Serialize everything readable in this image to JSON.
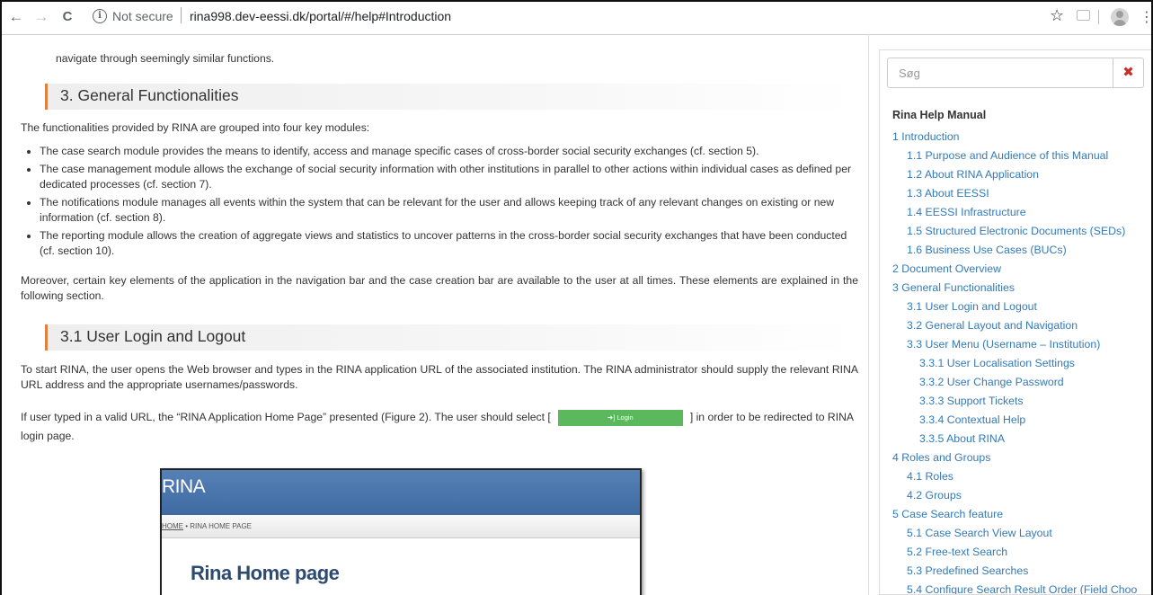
{
  "browser": {
    "back_icon": "←",
    "forward_icon": "→",
    "reload_icon": "C",
    "info_icon": "i",
    "security_label": "Not secure",
    "url": "rina998.dev-eessi.dk/portal/#/help#Introduction",
    "star_icon": "☆",
    "menu_icon": "⋮"
  },
  "content": {
    "top_line": "navigate through seemingly similar functions.",
    "section3_heading": "3. General Functionalities",
    "section3_intro": "The functionalities provided by RINA are grouped into four key modules:",
    "bullets": [
      "The case search module provides the means to identify, access and manage specific cases of cross-border social security exchanges (cf. section 5).",
      "The case management module allows the exchange of social security information with other institutions in parallel to other actions within individual cases as defined per dedicated processes (cf. section 7).",
      "The notifications module manages all events within the system that can be relevant for the user and allows keeping track of any relevant changes on existing or new information (cf. section 8).",
      "The reporting module allows the creation of aggregate views and statistics to uncover patterns in the cross-border social security exchanges that have been conducted (cf. section 10)."
    ],
    "moreover": "Moreover, certain key elements of the application in the navigation bar and the case creation bar are available to the user at all times. These elements are explained in the following section.",
    "section31_heading": "3.1 User Login and Logout",
    "login_para": "To start RINA, the user opens the Web browser and types in the RINA application URL of the associated institution. The RINA administrator should supply the relevant RINA URL address and the appropriate usernames/passwords.",
    "select_prefix": "If user typed in a valid URL, the “RINA Application Home Page” presented (Figure 2). The user should select [",
    "login_button": "➜] Login",
    "select_suffix": "] in order to be redirected to RINA login page.",
    "figure": {
      "logo": "RINA",
      "crumb_home": "HOME",
      "crumb_sep": " • ",
      "crumb_page": "RINA HOME PAGE",
      "title": "Rina Home page"
    }
  },
  "sidebar": {
    "search_placeholder": "Søg",
    "clear_icon": "✖",
    "toc_title": "Rina Help Manual",
    "items": [
      {
        "label": "1 Introduction",
        "level": 1
      },
      {
        "label": "1.1 Purpose and Audience of this Manual",
        "level": 2
      },
      {
        "label": "1.2 About RINA Application",
        "level": 2
      },
      {
        "label": "1.3 About EESSI",
        "level": 2
      },
      {
        "label": "1.4 EESSI Infrastructure",
        "level": 2
      },
      {
        "label": "1.5 Structured Electronic Documents (SEDs)",
        "level": 2
      },
      {
        "label": "1.6 Business Use Cases (BUCs)",
        "level": 2
      },
      {
        "label": "2 Document Overview",
        "level": 1
      },
      {
        "label": "3 General Functionalities",
        "level": 1
      },
      {
        "label": "3.1 User Login and Logout",
        "level": 2
      },
      {
        "label": "3.2 General Layout and Navigation",
        "level": 2
      },
      {
        "label": "3.3 User Menu (Username – Institution)",
        "level": 2
      },
      {
        "label": "3.3.1 User Localisation Settings",
        "level": 3
      },
      {
        "label": "3.3.2 User Change Password",
        "level": 3
      },
      {
        "label": "3.3.3 Support Tickets",
        "level": 3
      },
      {
        "label": "3.3.4 Contextual Help",
        "level": 3
      },
      {
        "label": "3.3.5 About RINA",
        "level": 3
      },
      {
        "label": "4 Roles and Groups",
        "level": 1
      },
      {
        "label": "4.1 Roles",
        "level": 2
      },
      {
        "label": "4.2 Groups",
        "level": 2
      },
      {
        "label": "5 Case Search feature",
        "level": 1
      },
      {
        "label": "5.1 Case Search View Layout",
        "level": 2
      },
      {
        "label": "5.2 Free-text Search",
        "level": 2
      },
      {
        "label": "5.3 Predefined Searches",
        "level": 2
      },
      {
        "label": "5.4 Configure Search Result Order (Field Choo",
        "level": 2
      }
    ]
  }
}
